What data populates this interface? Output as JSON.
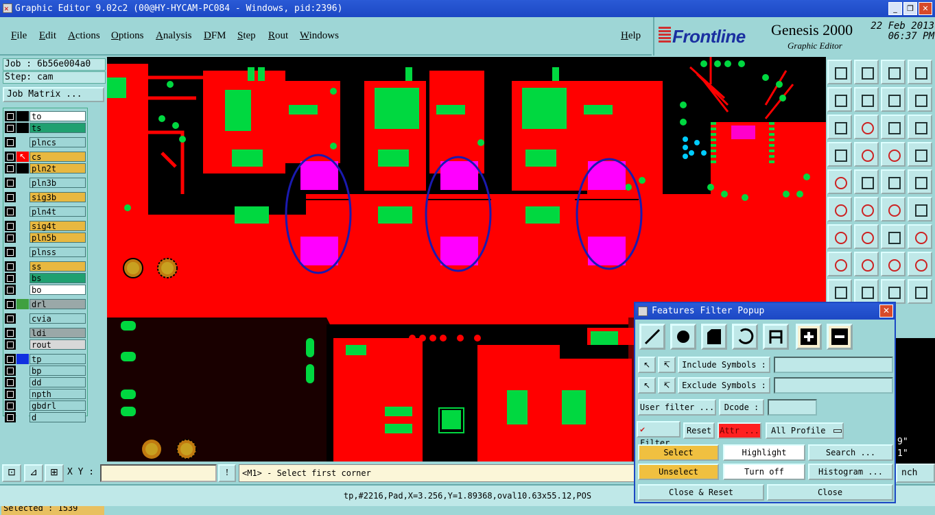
{
  "window": {
    "title": "Graphic Editor 9.02c2 (00@HY-HYCAM-PC084 - Windows, pid:2396)",
    "min": "_",
    "max": "❐",
    "close": "✕"
  },
  "menu": [
    "File",
    "Edit",
    "Actions",
    "Options",
    "Analysis",
    "DFM",
    "Step",
    "Rout",
    "Windows"
  ],
  "help": "Help",
  "brand": {
    "logo": "Frontline",
    "product": "Genesis 2000",
    "subtitle": "Graphic Editor",
    "date": "22 Feb 2013",
    "time": "06:37 PM"
  },
  "job": {
    "job_line": "Job : 6b56e004a0",
    "step_line": "Step: cam",
    "matrix_button": "Job Matrix ..."
  },
  "layers": [
    {
      "name": "to",
      "color": "#ffffff",
      "swatch": "#000000"
    },
    {
      "name": "ts",
      "color": "#20a070",
      "swatch": "#000000"
    },
    {
      "name": "plncs",
      "color": "#9ed6d6",
      "swatch": "#9ed6d6"
    },
    {
      "name": "cs",
      "color": "#e8b840",
      "swatch": "#ff0000",
      "active": true
    },
    {
      "name": "pln2t",
      "color": "#e8b840",
      "swatch": "#000000"
    },
    {
      "name": "pln3b",
      "color": "#9ed6d6",
      "swatch": "#9ed6d6"
    },
    {
      "name": "sig3b",
      "color": "#e8b840",
      "swatch": "#9ed6d6"
    },
    {
      "name": "pln4t",
      "color": "#9ed6d6",
      "swatch": "#9ed6d6"
    },
    {
      "name": "sig4t",
      "color": "#e8b840",
      "swatch": "#9ed6d6"
    },
    {
      "name": "pln5b",
      "color": "#e8b840",
      "swatch": "#9ed6d6"
    },
    {
      "name": "plnss",
      "color": "#9ed6d6",
      "swatch": "#9ed6d6"
    },
    {
      "name": "ss",
      "color": "#e8b840",
      "swatch": "#9ed6d6"
    },
    {
      "name": "bs",
      "color": "#20a070",
      "swatch": "#9ed6d6"
    },
    {
      "name": "bo",
      "color": "#ffffff",
      "swatch": "#9ed6d6"
    },
    {
      "name": "drl",
      "color": "#9aa8a8",
      "swatch": "#40a040"
    },
    {
      "name": "cvia",
      "color": "#9ed6d6",
      "swatch": "#9ed6d6"
    },
    {
      "name": "ldi",
      "color": "#9aa8a8",
      "swatch": "#9ed6d6"
    },
    {
      "name": "rout",
      "color": "#d8d8d8",
      "swatch": "#9ed6d6"
    },
    {
      "name": "tp",
      "color": "#9ed6d6",
      "swatch": "#1030e0"
    },
    {
      "name": "bp",
      "color": "#9ed6d6",
      "swatch": "#9ed6d6"
    },
    {
      "name": "dd",
      "color": "#9ed6d6",
      "swatch": "#9ed6d6"
    },
    {
      "name": "npth",
      "color": "#9ed6d6",
      "swatch": "#9ed6d6"
    },
    {
      "name": "gbdrl",
      "color": "#9ed6d6",
      "swatch": "#9ed6d6"
    },
    {
      "name": "d",
      "color": "#9ed6d6",
      "swatch": "#9ed6d6"
    }
  ],
  "selected": "Selected : 1539",
  "status": {
    "xy_label": "X Y :",
    "xy_value": "",
    "exclaim": "!",
    "prompt": "<M1> - Select first corner"
  },
  "info": "tp,#2216,Pad,X=3.256,Y=1.89368,oval10.63x55.12,POS",
  "partial_right": {
    "line1": "9\"",
    "line2": "1\"",
    "launch": "nch"
  },
  "popup": {
    "title": "Features Filter Popup",
    "include_label": "Include Symbols :",
    "include_value": "",
    "exclude_label": "Exclude Symbols :",
    "exclude_value": "",
    "user_filter": "User filter ...",
    "dcode_label": "Dcode :",
    "dcode_value": "",
    "filter_label": "Filter",
    "reset": "Reset",
    "attr": "Attr ...",
    "profile": "All Profile",
    "select": "Select",
    "highlight": "Highlight",
    "search": "Search ...",
    "unselect": "Unselect",
    "turn_off": "Turn off",
    "histogram": "Histogram ...",
    "close_reset": "Close & Reset",
    "close": "Close"
  },
  "colors": {
    "copper": "#ff0000",
    "pad": "#00d840",
    "magenta": "#ff00ff",
    "ellipse": "#1a1ab0",
    "title_blue": "#1c48c4"
  }
}
